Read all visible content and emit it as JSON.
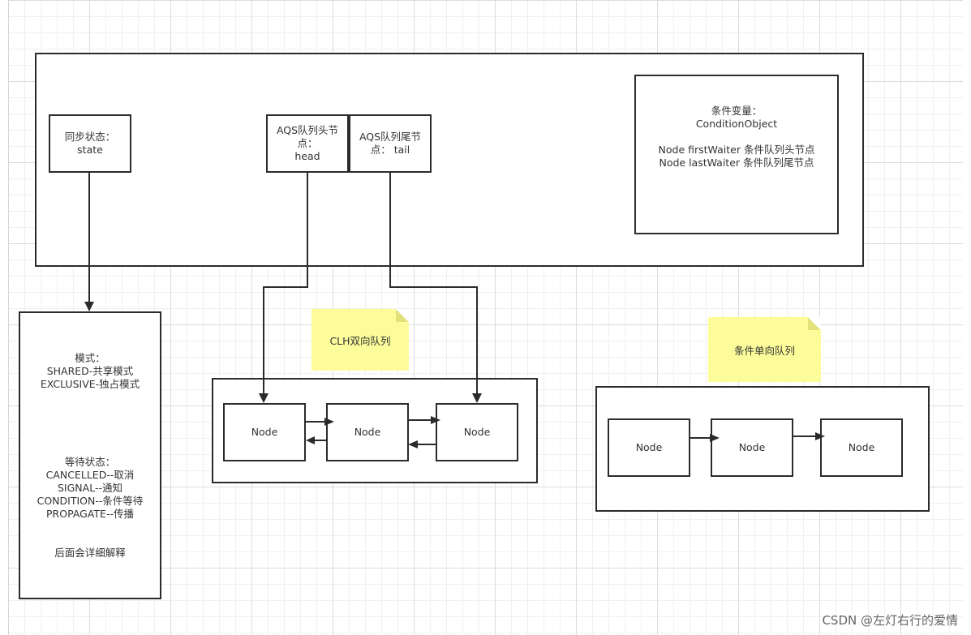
{
  "aqs": {
    "state_field": [
      "同步状态：",
      "state"
    ],
    "head_field": [
      "AQS队列头节",
      "点：",
      "head"
    ],
    "tail_field": [
      "AQS队列尾节",
      "点： tail"
    ],
    "condition_field": [
      "条件变量：",
      "ConditionObject",
      "",
      "Node firstWaiter 条件队列头节点",
      "Node lastWaiter 条件队列尾节点"
    ]
  },
  "state_detail": {
    "mode_lines": [
      "模式：",
      "SHARED-共享模式",
      "EXCLUSIVE-独占模式"
    ],
    "wait_lines": [
      "等待状态：",
      "CANCELLED--取消",
      "SIGNAL--通知",
      "CONDITION--条件等待",
      "PROPAGATE--传播"
    ],
    "note": "后面会详细解释"
  },
  "clh_queue": {
    "label": "CLH双向队列",
    "nodes": [
      "Node",
      "Node",
      "Node"
    ]
  },
  "condition_queue": {
    "label": "条件单向队列",
    "nodes": [
      "Node",
      "Node",
      "Node"
    ]
  },
  "watermark": "CSDN @左灯右行的爱情",
  "colors": {
    "stroke": "#2b2b2b",
    "note_fill": "#fcfc9a",
    "grid": "#dcdcdc"
  }
}
